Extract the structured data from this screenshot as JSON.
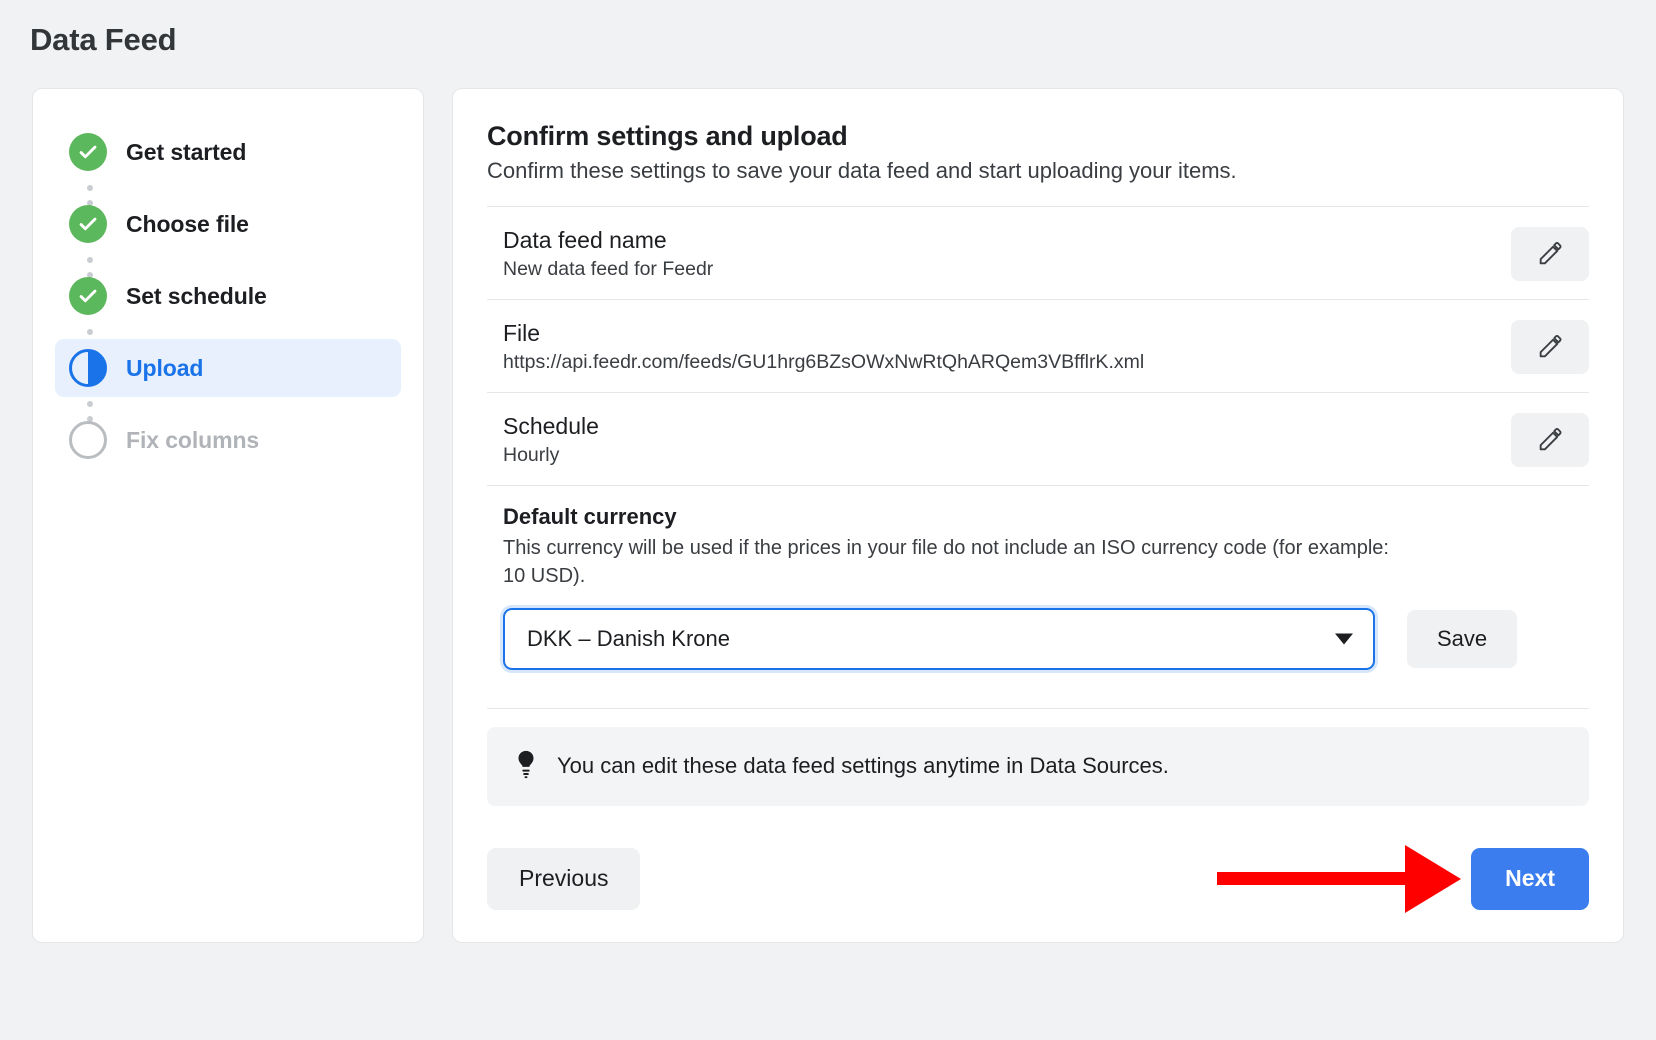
{
  "page": {
    "title": "Data Feed"
  },
  "stepper": {
    "steps": [
      {
        "label": "Get started",
        "state": "done",
        "icon": "check-circle-icon"
      },
      {
        "label": "Choose file",
        "state": "done",
        "icon": "check-circle-icon"
      },
      {
        "label": "Set schedule",
        "state": "done",
        "icon": "check-circle-icon"
      },
      {
        "label": "Upload",
        "state": "active",
        "icon": "half-filled-circle-icon"
      },
      {
        "label": "Fix columns",
        "state": "pending",
        "icon": "empty-circle-icon"
      }
    ]
  },
  "main": {
    "title": "Confirm settings and upload",
    "subtitle": "Confirm these settings to save your data feed and start uploading your items.",
    "settings": [
      {
        "label": "Data feed name",
        "value": "New data feed for Feedr",
        "edit_icon": "pencil-icon"
      },
      {
        "label": "File",
        "value": "https://api.feedr.com/feeds/GU1hrg6BZsOWxNwRtQhARQem3VBfflrK.xml",
        "edit_icon": "pencil-icon"
      },
      {
        "label": "Schedule",
        "value": "Hourly",
        "edit_icon": "pencil-icon"
      }
    ],
    "currency": {
      "title": "Default currency",
      "description": "This currency will be used if the prices in your file do not include an ISO currency code (for example: 10 USD).",
      "selected": "DKK – Danish Krone",
      "options": [
        "DKK – Danish Krone"
      ],
      "save_label": "Save",
      "caret_icon": "chevron-down-icon"
    },
    "tip": {
      "icon": "lightbulb-icon",
      "text": "You can edit these data feed settings anytime in Data Sources."
    },
    "footer": {
      "previous_label": "Previous",
      "next_label": "Next",
      "annotation_icon": "red-arrow-right-icon"
    }
  },
  "colors": {
    "accent_blue": "#1a73e8",
    "next_button_blue": "#3b7def",
    "step_done_green": "#5cb85c",
    "annotation_red": "#ff0000",
    "page_background": "#f1f2f3"
  }
}
